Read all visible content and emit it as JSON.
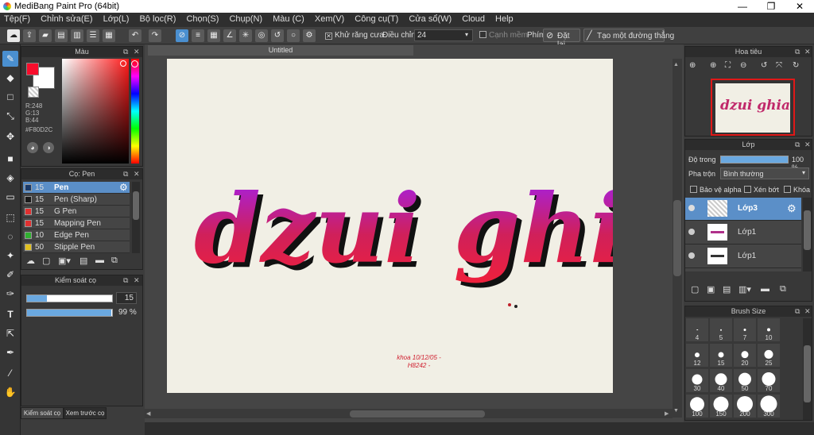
{
  "window": {
    "title": "MediBang Paint Pro (64bit)",
    "min": "—",
    "max": "❐",
    "close": "✕"
  },
  "menu": [
    "Tệp(F)",
    "Chỉnh sửa(E)",
    "Lớp(L)",
    "Bộ lọc(R)",
    "Chọn(S)",
    "Chụp(N)",
    "Màu (C)",
    "Xem(V)",
    "Công cụ(T)",
    "Cửa sổ(W)",
    "Cloud",
    "Help"
  ],
  "toolbar": {
    "antialias_label": "Khử răng cưa",
    "adjust_label": "Điều chỉnh",
    "adjust_value": "24",
    "edge_label": "Cạnh mềm",
    "key_label": "Phím",
    "reset_label": "Đặt lại",
    "straight_label": "Tạo một đường thẳng"
  },
  "color_panel": {
    "title": "Màu",
    "r": "R:248",
    "g": "G:13",
    "b": "B:44",
    "hex": "#F80D2C",
    "primary": "#F80D2C"
  },
  "brush_panel": {
    "title": "Cọ: Pen",
    "items": [
      {
        "size": "15",
        "name": "Pen",
        "color": "#1a3a6a"
      },
      {
        "size": "15",
        "name": "Pen (Sharp)",
        "color": "#1a1a1a"
      },
      {
        "size": "15",
        "name": "G Pen",
        "color": "#e03030"
      },
      {
        "size": "15",
        "name": "Mapping Pen",
        "color": "#e03030"
      },
      {
        "size": "10",
        "name": "Edge Pen",
        "color": "#30b030"
      },
      {
        "size": "50",
        "name": "Stipple Pen",
        "color": "#e0c020"
      }
    ]
  },
  "brush_control": {
    "title": "Kiểm soát cọ",
    "size": "15",
    "size_fraction": 0.23,
    "opacity": "99 %",
    "opacity_fraction": 0.99
  },
  "bottom_tabs": [
    "Kiểm soát cọ",
    "Xem trước cọ"
  ],
  "document": {
    "tab": "Untitled",
    "artwork_text": "dzui ghia",
    "signature": "khoa 10/12/05 - H8242 -"
  },
  "navigator": {
    "title": "Hoa tiêu"
  },
  "layer_panel": {
    "title": "Lớp",
    "opacity_label": "Độ trong",
    "opacity_value": "100 %",
    "opacity_fraction": 1.0,
    "blend_label": "Pha trộn",
    "blend_value": "Bình thường",
    "protect_alpha": "Bảo vệ alpha",
    "clipping": "Xén bớt",
    "lock": "Khóa",
    "layers": [
      "Lớp3",
      "Lớp1",
      "Lớp1"
    ]
  },
  "brush_size_panel": {
    "title": "Brush Size",
    "sizes": [
      "4",
      "5",
      "7",
      "10",
      "12",
      "15",
      "20",
      "25",
      "30",
      "40",
      "50",
      "70",
      "100",
      "150",
      "200",
      "300"
    ]
  }
}
